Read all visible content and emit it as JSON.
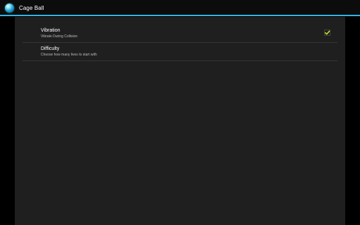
{
  "app": {
    "title": "Cage Ball",
    "icon": "ball-app-icon"
  },
  "colors": {
    "accent": "#33b5e5",
    "checkmark": "#c8e01a",
    "panel_bg": "#1f1f1f",
    "divider": "#353535"
  },
  "preferences": [
    {
      "title": "Vibration",
      "summary": "Vibrate During Collision",
      "checked": true,
      "icon": "checkmark-icon"
    },
    {
      "title": "Difficulty",
      "summary": "Choose how many lives to start with"
    }
  ]
}
